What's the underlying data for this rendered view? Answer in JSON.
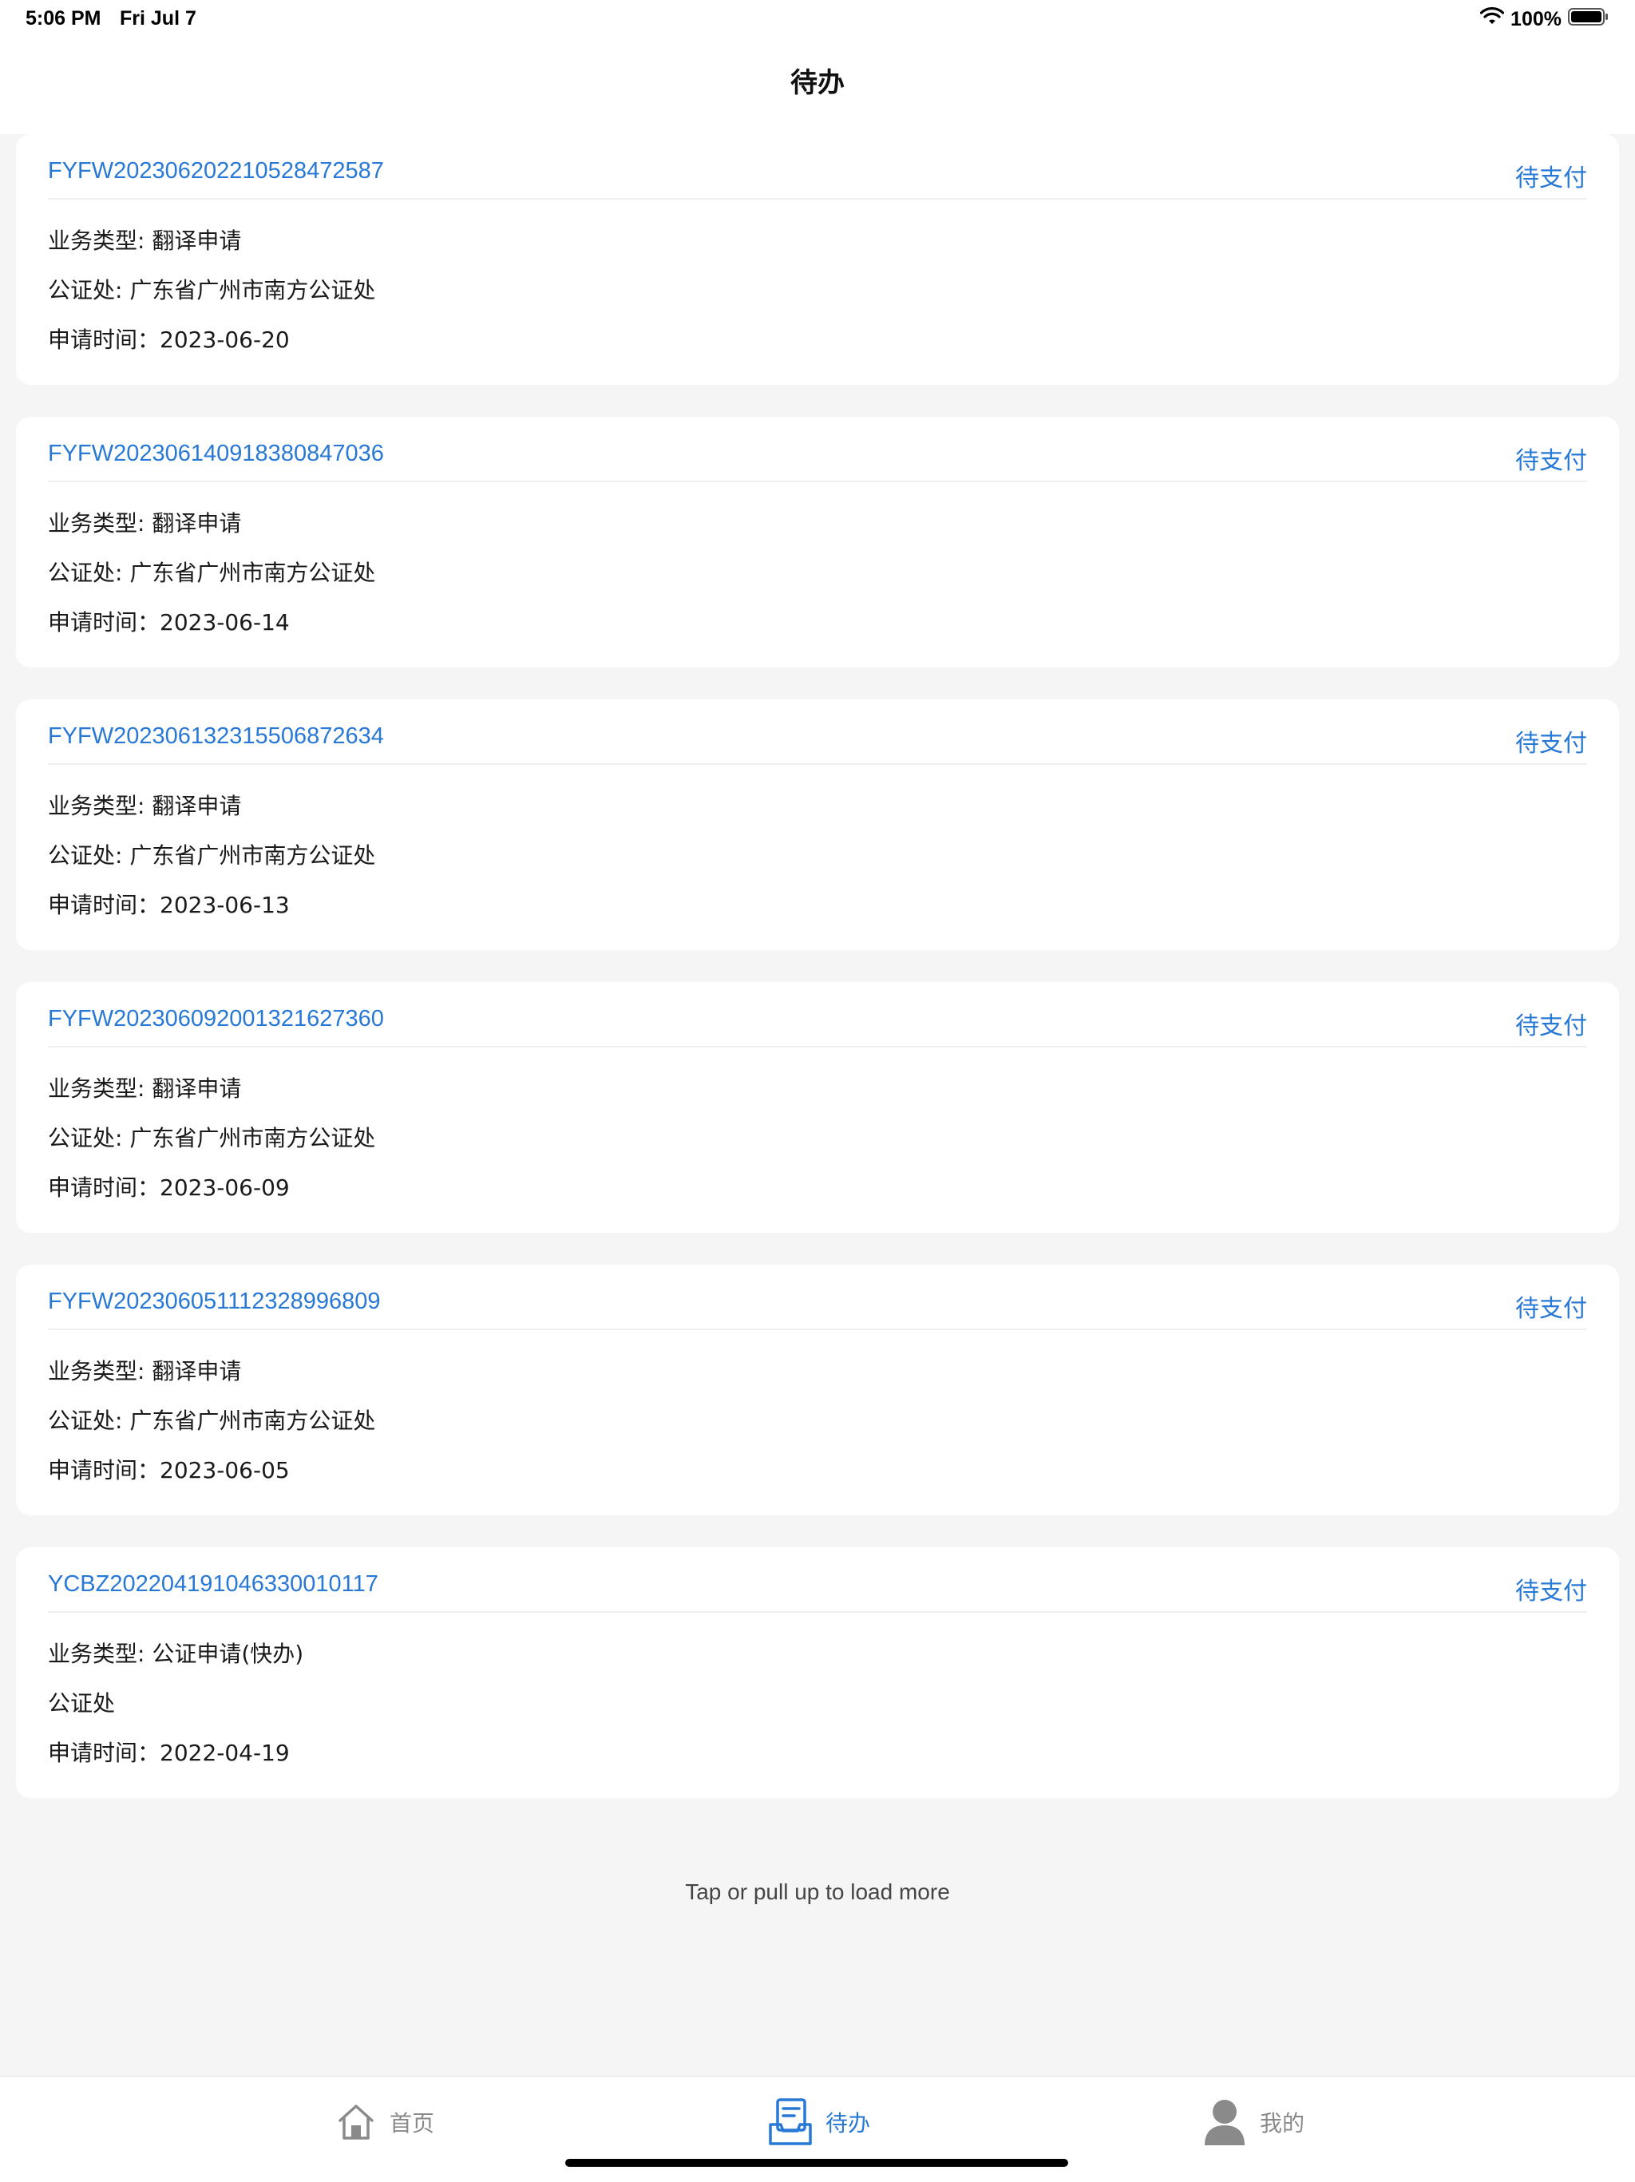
{
  "status_bar": {
    "time": "5:06 PM",
    "date": "Fri Jul 7",
    "battery_percent": "100%",
    "icons": [
      "wifi-icon",
      "battery-icon"
    ]
  },
  "header": {
    "title": "待办"
  },
  "orders": [
    {
      "number": "FYFW20230620221052847258​7",
      "status": "待支付",
      "business_type": "业务类型: 翻译申请",
      "notary_office": "公证处: 广东省广州市南方公证处",
      "apply_time": "申请时间：2023-06-20"
    },
    {
      "number": "FYFW20230614091838084703​6",
      "status": "待支付",
      "business_type": "业务类型: 翻译申请",
      "notary_office": "公证处: 广东省广州市南方公证处",
      "apply_time": "申请时间：2023-06-14"
    },
    {
      "number": "FYFW20230613231550687263​4",
      "status": "待支付",
      "business_type": "业务类型: 翻译申请",
      "notary_office": "公证处: 广东省广州市南方公证处",
      "apply_time": "申请时间：2023-06-13"
    },
    {
      "number": "FYFW20230609200132162736​0",
      "status": "待支付",
      "business_type": "业务类型: 翻译申请",
      "notary_office": "公证处: 广东省广州市南方公证处",
      "apply_time": "申请时间：2023-06-09"
    },
    {
      "number": "FYFW20230605111232899680​9",
      "status": "待支付",
      "business_type": "业务类型: 翻译申请",
      "notary_office": "公证处: 广东省广州市南方公证处",
      "apply_time": "申请时间：2023-06-05"
    },
    {
      "number": "YCBZ20220419104633001011​7",
      "status": "待支付",
      "business_type": "业务类型: 公证申请(快办)",
      "notary_office": "公证处",
      "apply_time": "申请时间：2022-04-19"
    }
  ],
  "load_more": "Tap or pull up to load more",
  "tab_bar": {
    "active": "todo",
    "colors": {
      "active": "#2878d6",
      "inactive": "#8a8a8a"
    },
    "tabs": [
      {
        "id": "home",
        "label": "首页",
        "icon": "home-icon"
      },
      {
        "id": "todo",
        "label": "待办",
        "icon": "todo-list-icon"
      },
      {
        "id": "mine",
        "label": "我的",
        "icon": "user-icon"
      }
    ]
  }
}
